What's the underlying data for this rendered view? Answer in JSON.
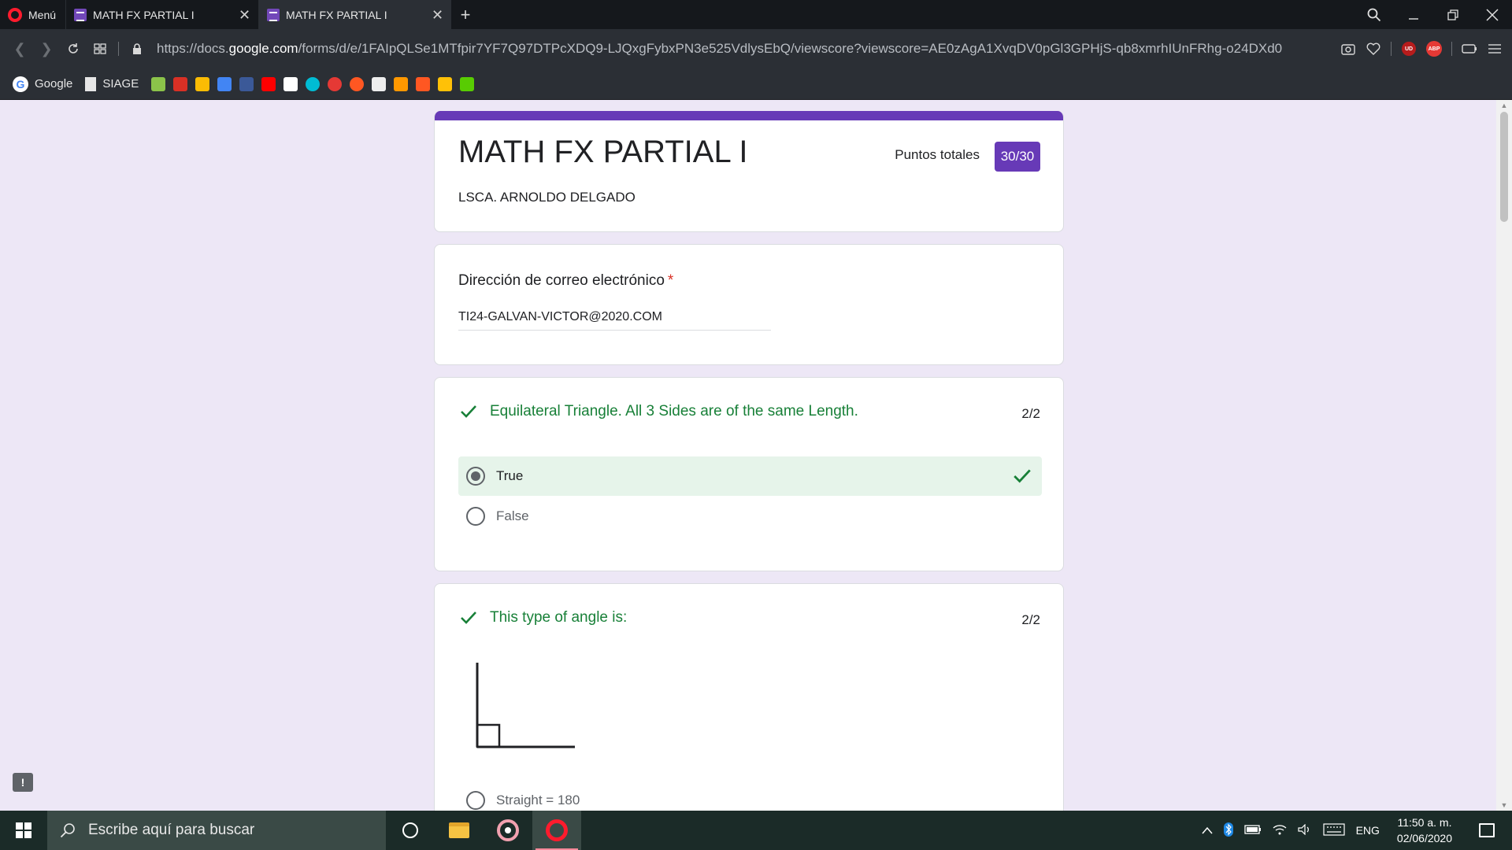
{
  "browser": {
    "menu_label": "Menú",
    "tabs": [
      {
        "title": "MATH FX PARTIAL I",
        "active": false
      },
      {
        "title": "MATH FX PARTIAL I",
        "active": true
      }
    ],
    "url_prefix": "https://docs.",
    "url_domain": "google.com",
    "url_rest": "/forms/d/e/1FAIpQLSe1MTfpir7YF7Q97DTPcXDQ9-LJQxgFybxPN3e525VdlysEbQ/viewscore?viewscore=AE0zAgA1XvqDV0pGl3GPHjS-qb8xmrhIUnFRhg-o24DXd0",
    "extensions": {
      "ublock": "UD",
      "adblock": "ABP"
    },
    "bookmarks": [
      {
        "label": "Google",
        "icon": "google-icon"
      },
      {
        "label": "SIAGE",
        "icon": "document-icon"
      }
    ],
    "bookmark_icon_colors": [
      "#8bc34a",
      "#d93025",
      "#fbbc04",
      "#4285f4",
      "#3b5998",
      "#ff0000",
      "#ffffff",
      "#00bcd4",
      "#e53935",
      "#ff5722",
      "#eeeeee",
      "#ff9800",
      "#ff5722",
      "#ffc107",
      "#58cc02"
    ]
  },
  "form": {
    "title": "MATH FX PARTIAL I",
    "description": "LSCA. ARNOLDO DELGADO",
    "score_label": "Puntos totales",
    "score_value": "30/30",
    "accent_color": "#673ab7",
    "correct_color": "#188038"
  },
  "email_question": {
    "label": "Dirección de correo electrónico",
    "required_mark": "*",
    "value": "TI24-GALVAN-VICTOR@2020.COM"
  },
  "questions": [
    {
      "text": "Equilateral Triangle. All 3 Sides are of the same Length.",
      "points": "2/2",
      "status": "correct",
      "options": [
        {
          "label": "True",
          "selected": true,
          "correct": true
        },
        {
          "label": "False",
          "selected": false,
          "correct": false
        }
      ]
    },
    {
      "text": "This type of angle is:",
      "points": "2/2",
      "status": "correct",
      "image": "right-angle-figure",
      "options": [
        {
          "label": "Straight = 180",
          "selected": false
        }
      ]
    }
  ],
  "taskbar": {
    "search_placeholder": "Escribe aquí para buscar",
    "language": "ENG",
    "time": "11:50 a. m.",
    "date": "02/06/2020"
  }
}
